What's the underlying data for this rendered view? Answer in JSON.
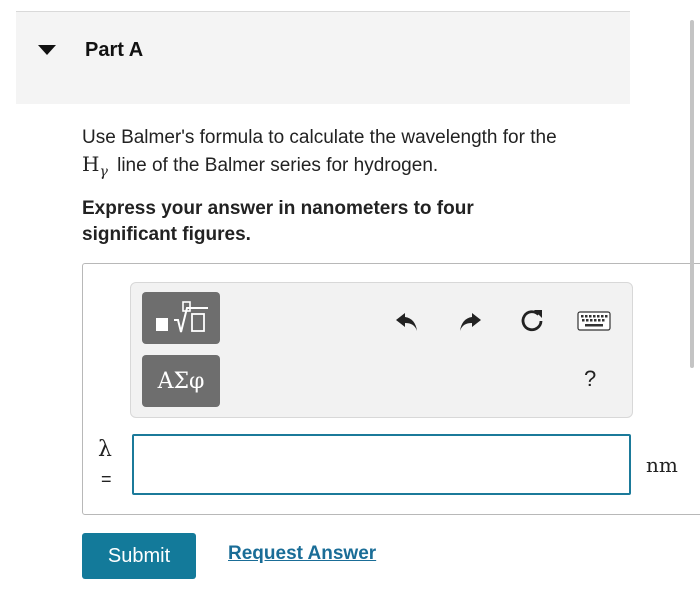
{
  "part": {
    "title": "Part A"
  },
  "question": {
    "text_before": "Use Balmer's formula to calculate the wavelength for the",
    "symbol_main": "H",
    "symbol_sub": "γ",
    "text_after": "line of the Balmer series for hydrogen."
  },
  "instruction": "Express your answer in nanometers to four significant figures.",
  "toolbar": {
    "symbols_label": "ΑΣφ",
    "help_label": "?",
    "icons": {
      "templates": "templates-icon",
      "undo": "undo-icon",
      "redo": "redo-icon",
      "reset": "reset-icon",
      "keyboard": "keyboard-icon"
    }
  },
  "answer": {
    "variable": "λ",
    "equals": "=",
    "value": "",
    "unit": "nm"
  },
  "actions": {
    "submit_label": "Submit",
    "request_answer_label": "Request Answer"
  },
  "colors": {
    "accent": "#137a9a",
    "link": "#1a6d97",
    "header_bg": "#f4f4f4",
    "button_gray": "#6e6e6e"
  }
}
